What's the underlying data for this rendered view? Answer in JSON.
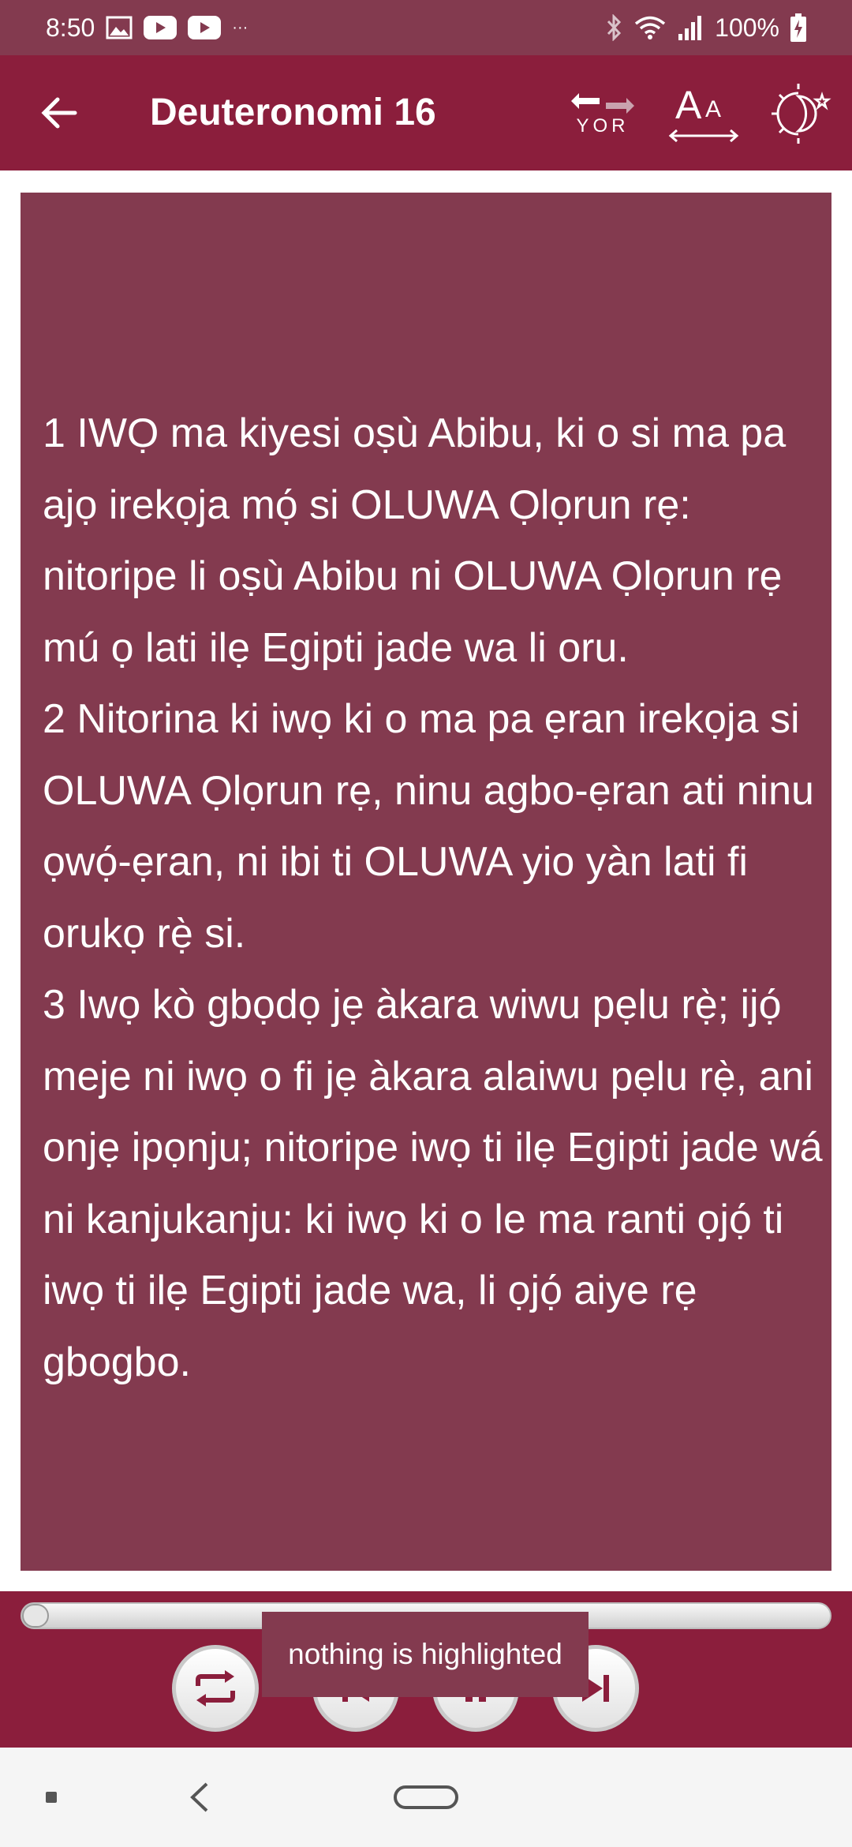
{
  "status_bar": {
    "time": "8:50",
    "more_indicator": "···",
    "battery": "100%",
    "icons": [
      "image-icon",
      "youtube-icon",
      "youtube-icon",
      "bluetooth-icon",
      "wifi-icon",
      "signal-icon",
      "battery-icon"
    ]
  },
  "app_bar": {
    "title": "Deuteronomi 16",
    "lang_label": "YOR",
    "font_label_big": "A",
    "font_label_small": "A",
    "icons": [
      "back-arrow-icon",
      "language-swap-icon",
      "font-size-icon",
      "day-night-theme-icon"
    ]
  },
  "reader": {
    "verses": [
      "1 IWỌ ma kiyesi oṣù Abibu, ki o si ma pa ajọ irekọja mọ́ si OLUWA Ọlọrun rẹ: nitoripe li oṣù Abibu ni OLUWA Ọlọrun rẹ mú ọ lati ilẹ Egipti jade wa li oru.",
      "2 Nitorina ki iwọ ki o ma pa ẹran irekọja si OLUWA Ọlọrun rẹ, ninu agbo-ẹran ati ninu ọwọ́-ẹran, ni ibi ti OLUWA yio yàn lati fi orukọ rẹ̀ si.",
      "3 Iwọ kò gbọdọ jẹ àkara wiwu pẹlu rẹ̀; ijọ́ meje ni iwọ o fi jẹ àkara alaiwu pẹlu rẹ̀, ani onjẹ ipọnju; nitoripe iwọ ti ilẹ Egipti jade wá ni kanjukanju: ki iwọ ki o le ma ranti ọjọ́ ti iwọ ti ilẹ Egipti jade wa, li ọjọ́ aiye rẹ gbogbo."
    ]
  },
  "player": {
    "progress": 0,
    "toast": "nothing is highlighted",
    "icons": [
      "repeat-icon",
      "previous-icon",
      "pause-icon",
      "next-icon"
    ]
  },
  "nav_bar": {
    "icons": [
      "recents-icon",
      "back-icon",
      "home-icon"
    ]
  },
  "colors": {
    "app_bar": "#8b1e3c",
    "reader_background": "#833a4f",
    "status_bar": "#833a4f",
    "text": "#ffffff"
  }
}
